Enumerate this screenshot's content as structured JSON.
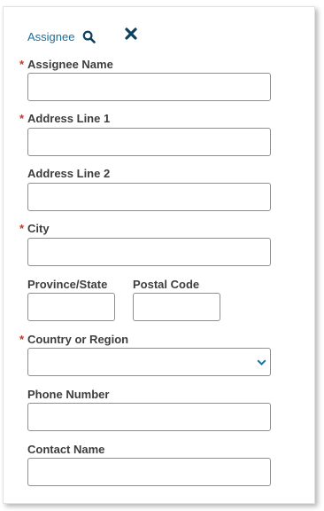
{
  "header": {
    "title": "Assignee"
  },
  "required_marker": "*",
  "form": {
    "assignee_name": {
      "label": "Assignee Name",
      "value": ""
    },
    "address_line_1": {
      "label": "Address Line 1",
      "value": ""
    },
    "address_line_2": {
      "label": "Address Line 2",
      "value": ""
    },
    "city": {
      "label": "City",
      "value": ""
    },
    "province_state": {
      "label": "Province/State",
      "value": ""
    },
    "postal_code": {
      "label": "Postal Code",
      "value": ""
    },
    "country_or_region": {
      "label": "Country or Region",
      "selected": ""
    },
    "phone_number": {
      "label": "Phone Number",
      "value": ""
    },
    "contact_name": {
      "label": "Contact Name",
      "value": ""
    }
  },
  "colors": {
    "link_blue": "#1f6e99",
    "icon_navy": "#10405e",
    "required_red": "#c0392b",
    "label_gray": "#3d3d3d",
    "border_gray": "#8e8e8e"
  },
  "icons": {
    "search": "search-icon",
    "close": "close-icon",
    "dropdown": "chevron-down-icon"
  }
}
